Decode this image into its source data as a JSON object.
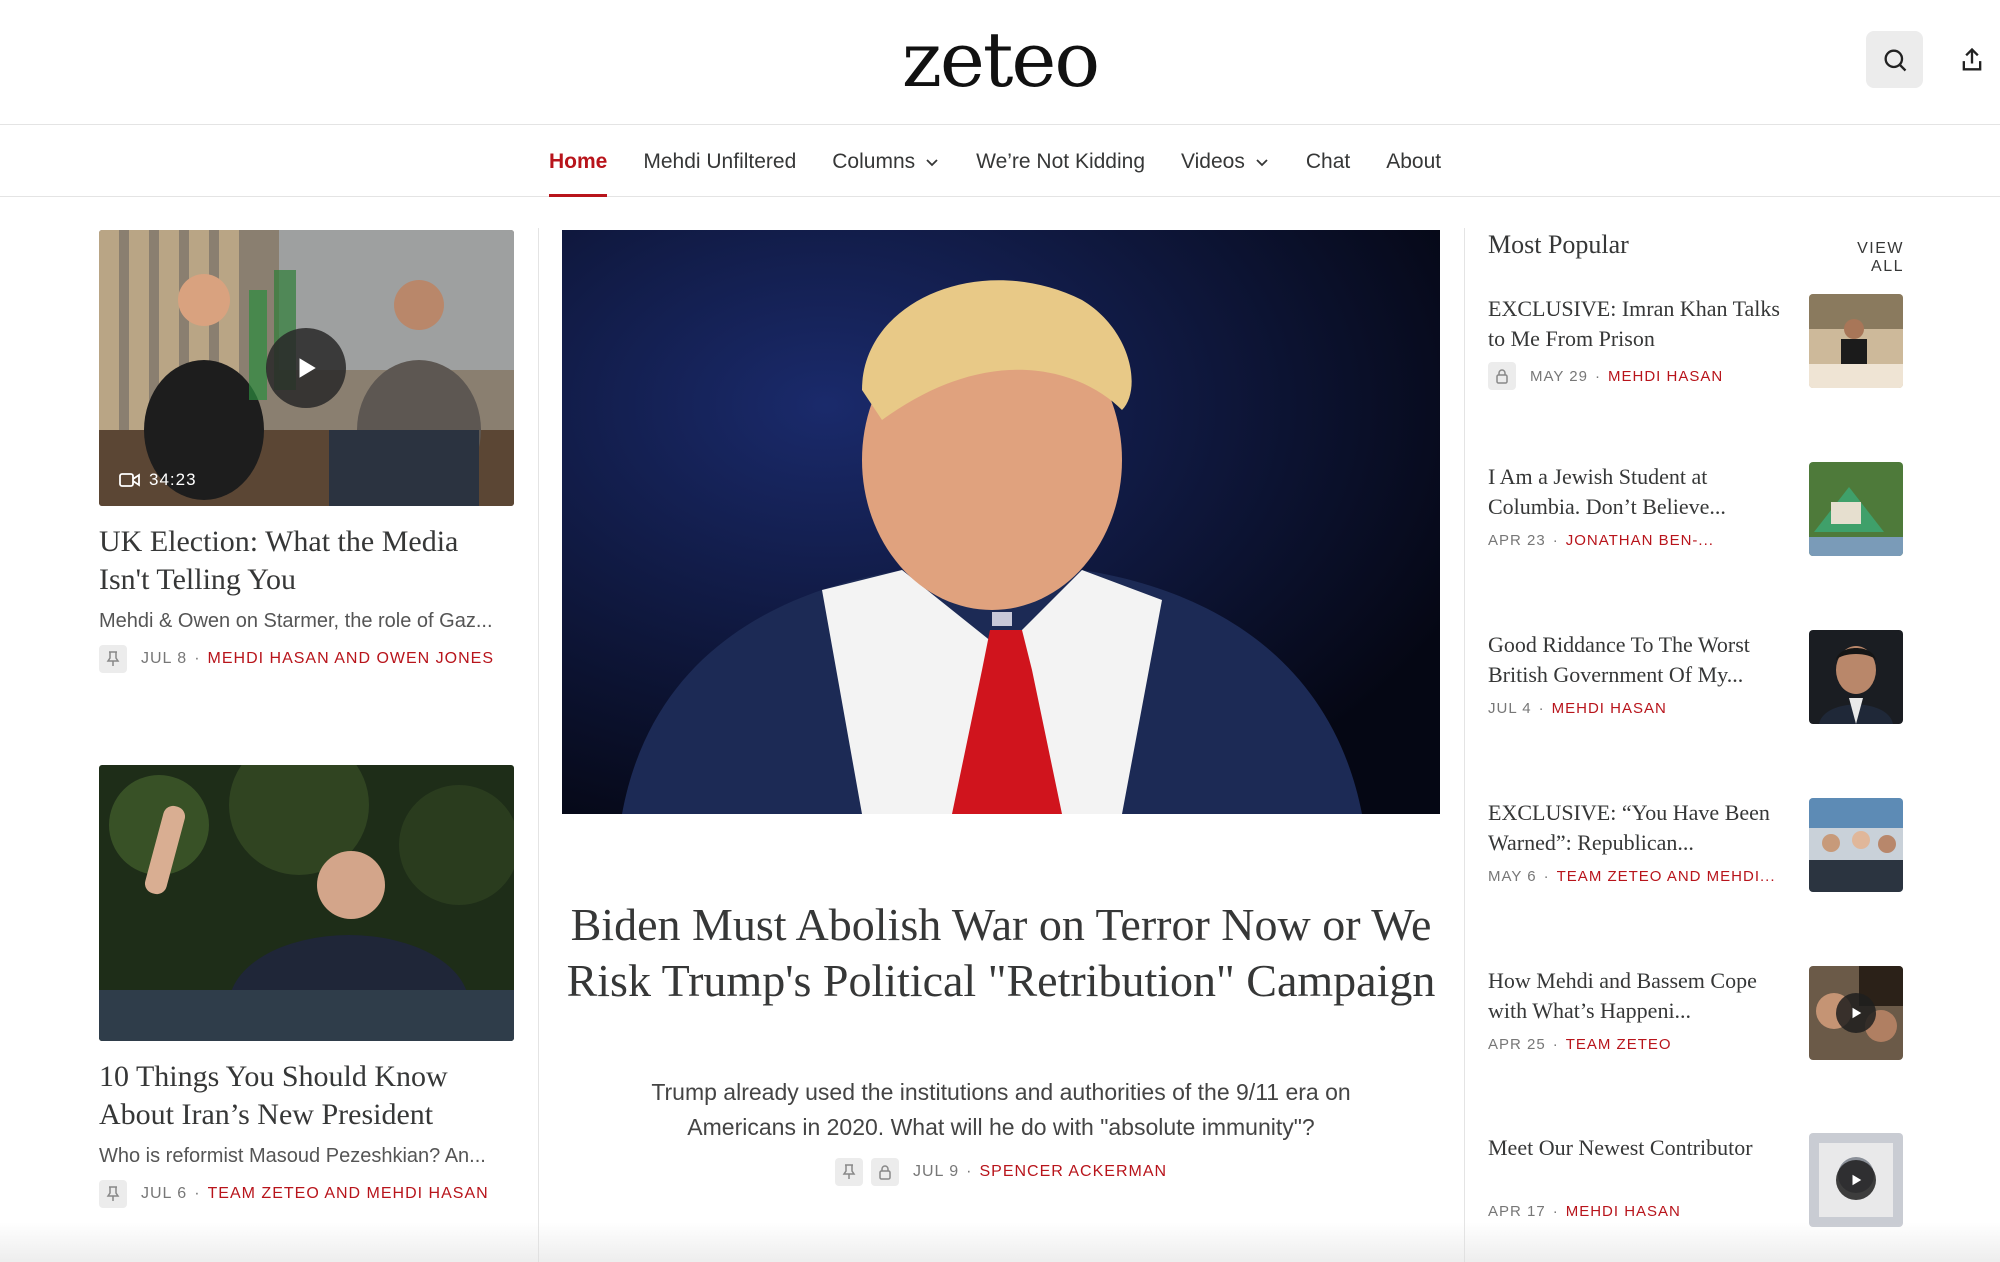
{
  "header": {
    "logo": "zeteo"
  },
  "nav": [
    {
      "label": "Home",
      "active": true
    },
    {
      "label": "Mehdi Unfiltered"
    },
    {
      "label": "Columns",
      "dropdown": true
    },
    {
      "label": "We’re Not Kidding"
    },
    {
      "label": "Videos",
      "dropdown": true
    },
    {
      "label": "Chat"
    },
    {
      "label": "About"
    }
  ],
  "left": {
    "card1": {
      "duration": "34:23",
      "title": "UK Election: What the Media Isn't Telling You",
      "subtitle": "Mehdi & Owen on Starmer, the role of Gaz...",
      "date": "JUL 8",
      "author": "MEHDI HASAN AND OWEN JONES"
    },
    "card2": {
      "title": "10 Things You Should Know About Iran’s New President",
      "subtitle": "Who is reformist Masoud Pezeshkian? An...",
      "date": "JUL 6",
      "author": "TEAM ZETEO AND MEHDI HASAN"
    }
  },
  "hero": {
    "title": "Biden Must Abolish War on Terror Now or We Risk Trump's Political \"Retribution\" Campaign",
    "subtitle": "Trump already used the institutions and authorities of the 9/11 era on Americans in 2020. What will he do with \"absolute immunity\"?",
    "date": "JUL 9",
    "author": "SPENCER ACKERMAN"
  },
  "popular": {
    "heading": "Most Popular",
    "view_all": "VIEW ALL",
    "items": [
      {
        "title": "EXCLUSIVE: Imran Khan Talks to Me From Prison",
        "date": "MAY 29",
        "author": "MEHDI HASAN",
        "locked": true
      },
      {
        "title": "I Am a Jewish Student at Columbia. Don’t Believe...",
        "date": "APR 23",
        "author": "JONATHAN BEN-..."
      },
      {
        "title": "Good Riddance To The Worst British Government Of My...",
        "date": "JUL 4",
        "author": "MEHDI HASAN"
      },
      {
        "title": "EXCLUSIVE: “You Have Been Warned”: Republican...",
        "date": "MAY 6",
        "author": "TEAM ZETEO AND MEHDI..."
      },
      {
        "title": "How Mehdi and Bassem Cope with What’s Happeni...",
        "date": "APR 25",
        "author": "TEAM ZETEO",
        "video": true
      },
      {
        "title": "Meet Our Newest Contributor",
        "date": "APR 17",
        "author": "MEHDI HASAN",
        "video": true
      }
    ]
  },
  "colors": {
    "accent": "#b8141b",
    "text": "#363737",
    "muted": "#777777"
  },
  "icons": [
    "search-icon",
    "share-icon",
    "chevron-down-icon",
    "play-icon",
    "video-camera-icon",
    "pin-icon",
    "lock-icon"
  ]
}
